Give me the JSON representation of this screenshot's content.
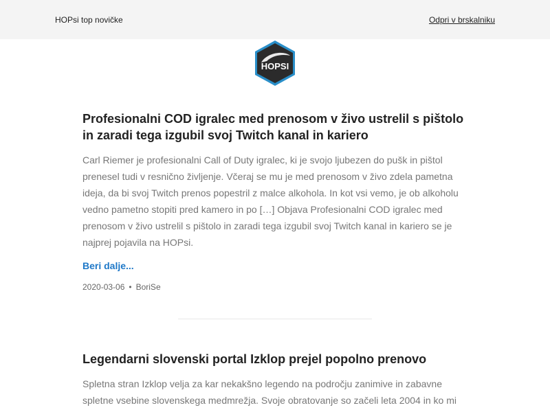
{
  "topbar": {
    "title": "HOPsi top novičke",
    "open_link": "Odpri v brskalniku"
  },
  "logo": {
    "text": "HOPSI",
    "colors": {
      "outer": "#2a8fc9",
      "inner": "#2b2b2b",
      "text": "#ffffff"
    }
  },
  "articles": [
    {
      "title": "Profesionalni COD igralec med prenosom v živo ustrelil s pištolo in zaradi tega izgubil svoj Twitch kanal in kariero",
      "excerpt": "Carl Riemer je profesionalni Call of Duty igralec, ki je svojo ljubezen do pušk in pištol prenesel tudi v resnično življenje. Včeraj se mu je med prenosom v živo zdela pametna ideja, da bi svoj Twitch prenos popestril z malce alkohola. In kot vsi vemo, je ob alkoholu vedno pametno stopiti pred kamero in po […] Objava Profesionalni COD igralec med prenosom v živo ustrelil s pištolo in zaradi tega izgubil svoj Twitch kanal in kariero se je najprej pojavila na HOPsi.",
      "read_more": "Beri dalje...",
      "date": "2020-03-06",
      "separator": "•",
      "author": "BoriSe"
    },
    {
      "title": "Legendarni slovenski portal Izklop prejel popolno prenovo",
      "excerpt": "Spletna stran Izklop velja za kar nekakšno legendo na področju zanimive in zabavne spletne vsebine slovenskega medmrežja. Svoje obratovanje so začeli leta 2004 in ko mi"
    }
  ],
  "colors": {
    "topbar_bg": "#f4f4f4",
    "link_blue": "#1e78c8",
    "excerpt_gray": "#777777"
  }
}
